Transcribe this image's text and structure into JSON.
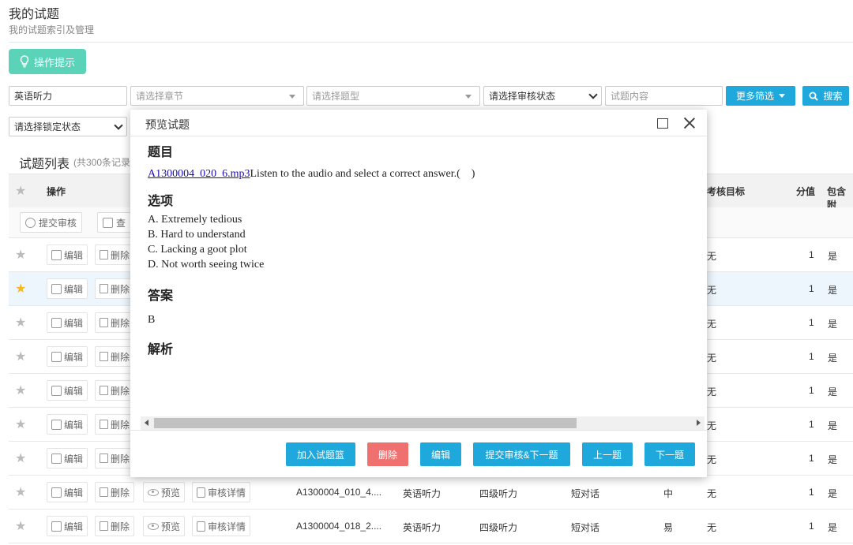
{
  "header": {
    "title": "我的试题",
    "subtitle": "我的试题索引及管理"
  },
  "tips_button": {
    "label": "操作提示"
  },
  "filters": {
    "subject": "英语听力",
    "chapter_placeholder": "请选择章节",
    "type_placeholder": "请选择题型",
    "review_status": "请选择审核状态",
    "content_placeholder": "试题内容",
    "more_filters": "更多筛选",
    "search": "搜索",
    "lock_status": "请选择锁定状态"
  },
  "list": {
    "title": "试题列表",
    "count": "(共300条记录",
    "headers": {
      "op": "操作",
      "target": "考核目标",
      "score": "分值",
      "include": "包含附"
    },
    "toolbar": {
      "submit_review": "提交审核",
      "view": "查"
    }
  },
  "row_actions": {
    "edit": "编辑",
    "delete": "删除",
    "preview": "预览",
    "review_detail": "审核详情",
    "delete_cut": "删除"
  },
  "rows": [
    {
      "starred": false,
      "target": "无",
      "score": "1",
      "include": "是"
    },
    {
      "starred": true,
      "target": "无",
      "score": "1",
      "include": "是"
    },
    {
      "starred": false,
      "target": "无",
      "score": "1",
      "include": "是"
    },
    {
      "starred": false,
      "target": "无",
      "score": "1",
      "include": "是"
    },
    {
      "starred": false,
      "target": "无",
      "score": "1",
      "include": "是"
    },
    {
      "starred": false,
      "target": "无",
      "score": "1",
      "include": "是"
    },
    {
      "starred": false,
      "target": "无",
      "score": "1",
      "include": "是"
    },
    {
      "starred": false,
      "code": "A1300004_010_4....",
      "subject": "英语听力",
      "level": "四级听力",
      "type": "短对话",
      "difficulty": "中",
      "target": "无",
      "score": "1",
      "include": "是"
    },
    {
      "starred": false,
      "code": "A1300004_018_2....",
      "subject": "英语听力",
      "level": "四级听力",
      "type": "短对话",
      "difficulty": "易",
      "target": "无",
      "score": "1",
      "include": "是"
    }
  ],
  "modal": {
    "title": "预览试题",
    "question_heading": "题目",
    "audio_link": "A1300004_020_6.mp3",
    "question_text": "Listen to the audio and select a correct answer.(　)",
    "options_heading": "选项",
    "options": [
      "A. Extremely tedious",
      "B. Hard to understand",
      "C. Lacking a goot plot",
      "D. Not worth seeing twice"
    ],
    "answer_heading": "答案",
    "answer": "B",
    "analysis_heading": "解析",
    "buttons": {
      "add_basket": "加入试题篮",
      "delete": "删除",
      "edit": "编辑",
      "submit_next": "提交审核&下一题",
      "prev": "上一题",
      "next": "下一题"
    }
  },
  "colors": {
    "primary": "#1fa8dc",
    "tips": "#5bd3b8",
    "danger": "#f07070",
    "star_on": "#f5b922"
  }
}
